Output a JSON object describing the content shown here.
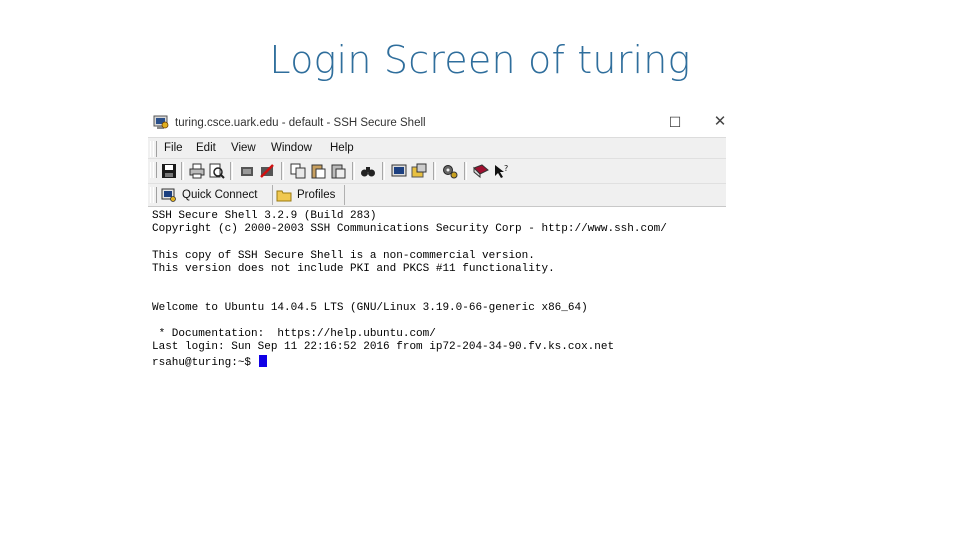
{
  "slide": {
    "title": "Login Screen of turing"
  },
  "window": {
    "title": "turing.csce.uark.edu - default - SSH Secure Shell",
    "maximize_icon": "maximize-icon",
    "close_icon": "close-icon"
  },
  "menu": {
    "items": [
      "File",
      "Edit",
      "View",
      "Window",
      "Help"
    ]
  },
  "toolbar": {
    "icons": [
      "save-icon",
      "print-icon",
      "print-preview-icon",
      "connect-icon",
      "disconnect-icon",
      "copy-icon",
      "paste-icon",
      "paste-special-icon",
      "find-icon",
      "new-terminal-icon",
      "new-file-transfer-icon",
      "settings-icon",
      "help-book-icon",
      "whats-this-icon"
    ]
  },
  "quickbar": {
    "quick_connect": "Quick Connect",
    "profiles": "Profiles"
  },
  "terminal": {
    "lines": [
      "SSH Secure Shell 3.2.9 (Build 283)",
      "Copyright (c) 2000-2003 SSH Communications Security Corp - http://www.ssh.com/",
      "",
      "This copy of SSH Secure Shell is a non-commercial version.",
      "This version does not include PKI and PKCS #11 functionality.",
      "",
      "",
      "Welcome to Ubuntu 14.04.5 LTS (GNU/Linux 3.19.0-66-generic x86_64)",
      "",
      " * Documentation:  https://help.ubuntu.com/",
      "Last login: Sun Sep 11 22:16:52 2016 from ip72-204-34-90.fv.ks.cox.net"
    ],
    "prompt": "rsahu@turing:~$ "
  },
  "colors": {
    "title": "#2f6e9c",
    "cursor": "#1000e6",
    "chrome": "#f0f0f0"
  }
}
